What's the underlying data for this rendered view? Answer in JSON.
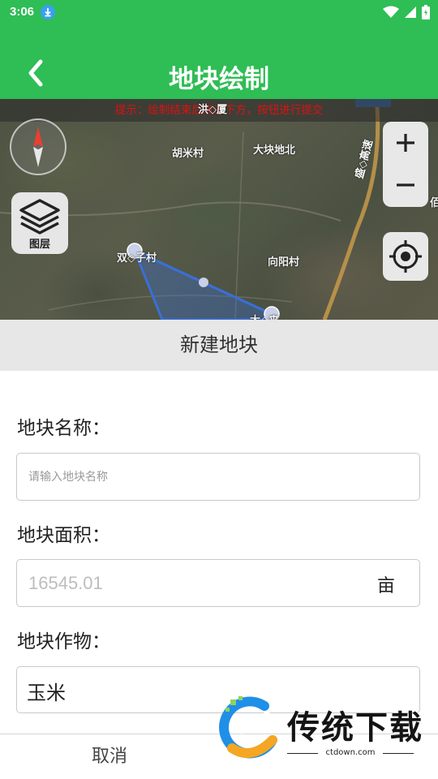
{
  "status_bar": {
    "time": "3:06"
  },
  "header": {
    "title": "地块绘制"
  },
  "map": {
    "hint": "提示：绘制结束后点击下方，按钮进行提交",
    "places": [
      "胡米村",
      "大块地北",
      "双◇子村",
      "向阳村",
      "洪◇厦",
      "大◇来",
      "盛◇高速",
      "佰"
    ],
    "layer_label": "图层"
  },
  "dialog": {
    "title": "新建地块",
    "name_label": "地块名称：",
    "name_placeholder": "请输入地块名称",
    "area_label": "地块面积：",
    "area_value": "16545.01",
    "area_unit": "亩",
    "crop_label": "地块作物：",
    "crop_value": "玉米",
    "cancel_label": "取消"
  },
  "watermark": {
    "text": "传统下载",
    "url": "ctdown.com"
  },
  "colors": {
    "brand_green": "#2fbd55",
    "polygon_blue": "#3a6fd8",
    "hint_red": "#dd1111"
  }
}
